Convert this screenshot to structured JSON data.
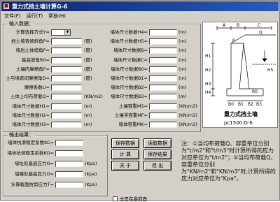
{
  "window": {
    "title": "重力式挡土墙计算G-6",
    "icon": "app-icon"
  },
  "menu": [
    "文件(F)",
    "运行(T)",
    "帮助(H)"
  ],
  "input_group": {
    "legend": "输入数据："
  },
  "left_fields": [
    {
      "label": "计算选择方式Y=",
      "unit": "",
      "type": "select",
      "value": ""
    },
    {
      "label": "挡土墙背倾斜角P=",
      "unit": "(度)"
    },
    {
      "label": "墙后土体坡角P=",
      "unit": "(度)"
    },
    {
      "label": "基底坡角R0=",
      "unit": "(度)"
    },
    {
      "label": "土壤内摩擦角F=",
      "unit": "(度)"
    },
    {
      "label": "土与墙背间摩擦角D=",
      "unit": "(度)"
    },
    {
      "label": "摩擦系数U=",
      "unit": ""
    },
    {
      "label": "土体上均布荷载Q=",
      "unit": "(KN/m2)"
    },
    {
      "label": "墙体尺寸数据H1=",
      "unit": "(m)"
    },
    {
      "label": "墙体尺寸数据H2=",
      "unit": "(m)"
    },
    {
      "label": "墙体尺寸数据H3=",
      "unit": "(m)"
    }
  ],
  "right_fields": [
    {
      "label": "墙体尺寸数据H4=",
      "unit": "(m)"
    },
    {
      "label": "墙体尺寸数据H5=",
      "unit": "(m)"
    },
    {
      "label": "墙体尺寸数据B=",
      "unit": "(m)"
    },
    {
      "label": "墙体尺寸数据C=",
      "unit": "(m)"
    },
    {
      "label": "墙体尺寸数据B0=",
      "unit": "(m)"
    },
    {
      "label": "墙体尺寸数据B1=",
      "unit": "(m)"
    },
    {
      "label": "墙体尺寸数据B2=",
      "unit": "(m)"
    },
    {
      "label": "墙体尺寸数据B3=",
      "unit": "(m)"
    },
    {
      "label": "土壤容重MS=",
      "unit": "(KN/m3)"
    },
    {
      "label": "土壤浮容重MF=",
      "unit": "(KN/m3)"
    },
    {
      "label": "墙体容重MK=",
      "unit": "(KN/m3)"
    }
  ],
  "output_group": {
    "legend": "输出结果："
  },
  "output_fields": [
    {
      "label": "墙体抗滑稳定系数KC=",
      "unit": ""
    },
    {
      "label": "墙体抗倾稳定系数KO=",
      "unit": ""
    },
    {
      "label": "墙址处基底应力O=",
      "unit": "(Kpa)"
    },
    {
      "label": "墙踵处基底应力O=",
      "unit": "(Kpa)"
    },
    {
      "label": "计算截面抗剪应力T=",
      "unit": "(Kpa)"
    }
  ],
  "buttons": {
    "save_data": "保存数据",
    "read_data": "读取数据",
    "calc": "计 算",
    "save_result": "保存结果",
    "about": "关 于",
    "exit": "退 出"
  },
  "checkbox": {
    "label": "总是在最前面"
  },
  "diagram": {
    "title": "重力式挡土墙",
    "code": "pc1500:G-6",
    "labels": [
      "A",
      "B",
      "C",
      "Q",
      "H1",
      "H2",
      "H3",
      "H4",
      "H5",
      "B0",
      "B1",
      "B2",
      "B3",
      "R0",
      "P"
    ]
  },
  "note": "注：①当均布荷载Q、容重单位分别为\"t/m2\"和\"t/m3\"时计算所得的应力对应单位为\"t/m2\"；②当均布荷载Q、容重单位分别为\"KN/m2\"和\"KN/m3\"时,计算所得的应力对应单位为\"Kpa\"。"
}
